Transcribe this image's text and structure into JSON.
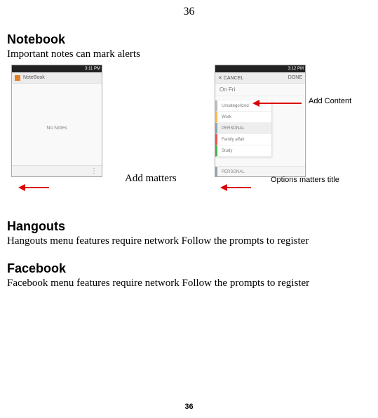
{
  "page": {
    "number_top": "36",
    "number_bottom": "36"
  },
  "sections": {
    "notebook": {
      "title": "Notebook",
      "desc": "Important notes can mark alerts"
    },
    "hangouts": {
      "title": "Hangouts",
      "desc": "Hangouts menu features require network Follow the prompts to register"
    },
    "facebook": {
      "title": "Facebook",
      "desc": "Facebook menu features require network Follow the prompts to register"
    }
  },
  "annotations": {
    "add_matters": "Add matters",
    "add_content": "Add Content",
    "options_title": "Options matters title"
  },
  "phone_left": {
    "status_time": "3:11 PM",
    "app_title": "NoteBook",
    "empty_text": "No Notes",
    "overflow": "⋮"
  },
  "phone_right": {
    "status_time": "3:12 PM",
    "cancel": "✕ CANCEL",
    "done": "DONE",
    "date": "On Fri",
    "categories": {
      "c1": "Uncategorized",
      "c2": "Work",
      "c3": "PERSONAL",
      "c4": "Family affair",
      "c5": "Study"
    },
    "selected": "PERSONAL"
  }
}
